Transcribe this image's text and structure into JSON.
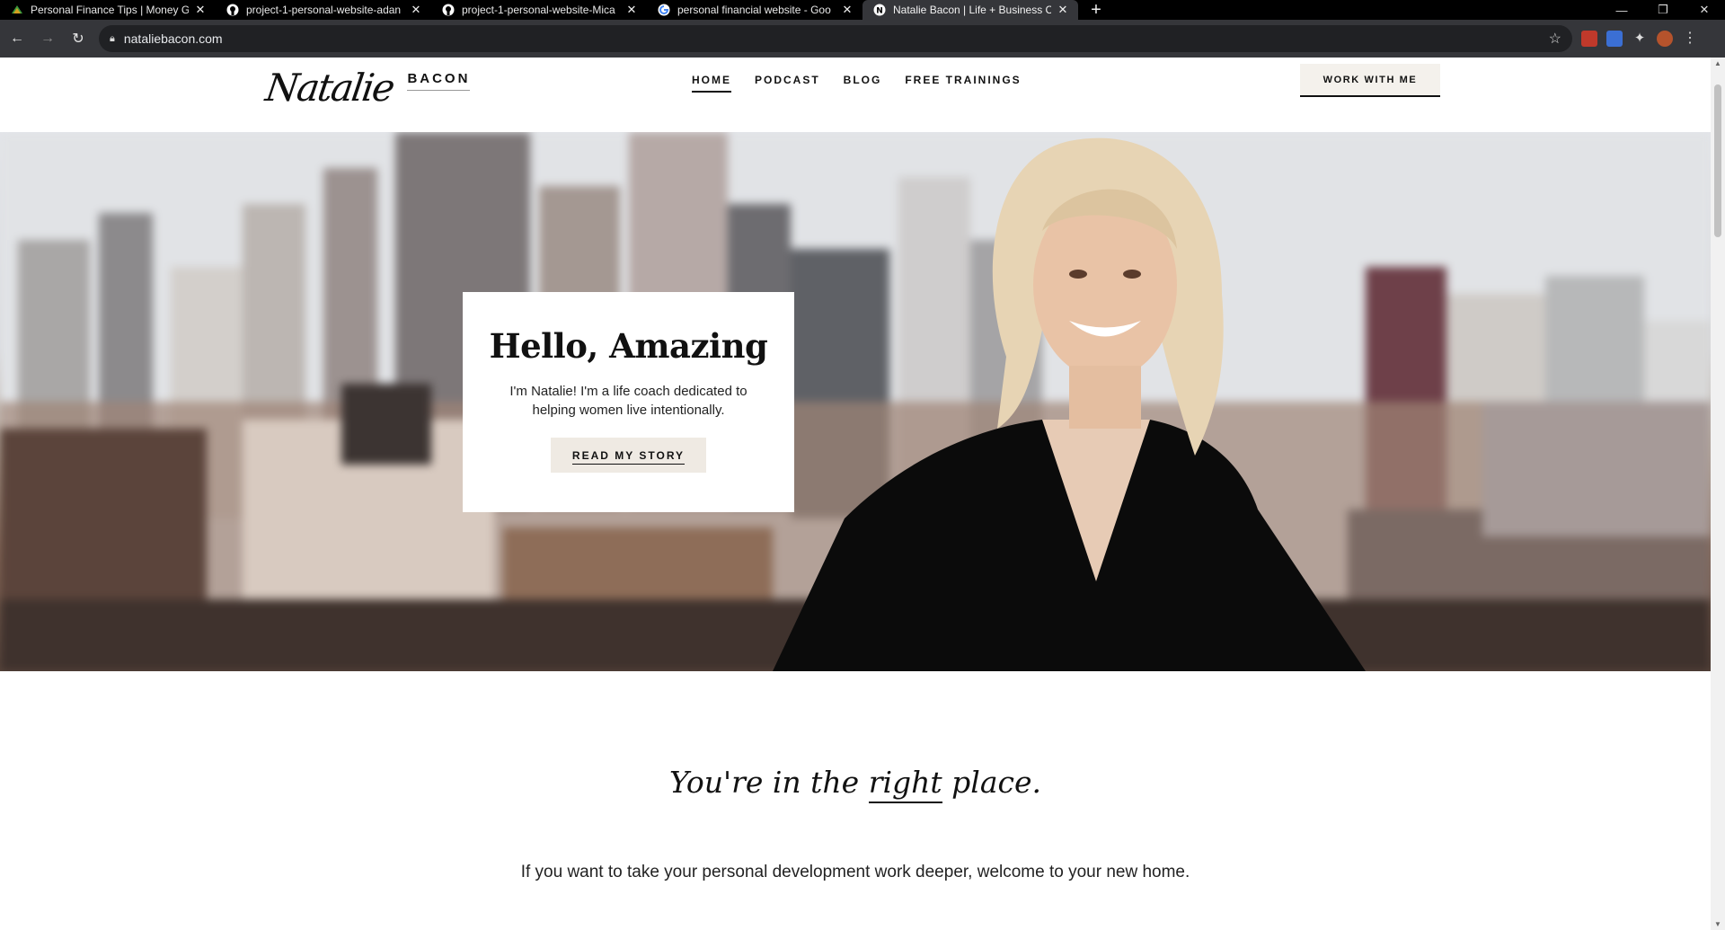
{
  "browser": {
    "tabs": [
      {
        "title": "Personal Finance Tips | Money Gi",
        "icon": "money-leaf-icon",
        "active": false
      },
      {
        "title": "project-1-personal-website-adan",
        "icon": "github-icon",
        "active": false
      },
      {
        "title": "project-1-personal-website-Mica",
        "icon": "github-icon",
        "active": false
      },
      {
        "title": "personal financial website - Goo",
        "icon": "google-icon",
        "active": false
      },
      {
        "title": "Natalie Bacon | Life + Business C",
        "icon": "nb-icon",
        "active": true
      }
    ],
    "url": "nataliebacon.com"
  },
  "site": {
    "logo_script": "Natalie",
    "logo_word": "BACON",
    "nav": [
      "HOME",
      "PODCAST",
      "BLOG",
      "FREE TRAININGS"
    ],
    "cta": "WORK WITH ME"
  },
  "hero": {
    "heading": "Hello, Amazing",
    "text": "I'm Natalie! I'm a life coach dedicated to helping women live intentionally.",
    "button": "READ MY STORY"
  },
  "intro": {
    "tagline_before": "You're in the ",
    "tagline_emphasis": "right",
    "tagline_after": " place.",
    "text": "If you want to take your personal development work deeper, welcome to your new home."
  },
  "colors": {
    "chrome_dark": "#000000",
    "toolbar": "#35363a",
    "accent_beige": "#f4f1ec"
  }
}
